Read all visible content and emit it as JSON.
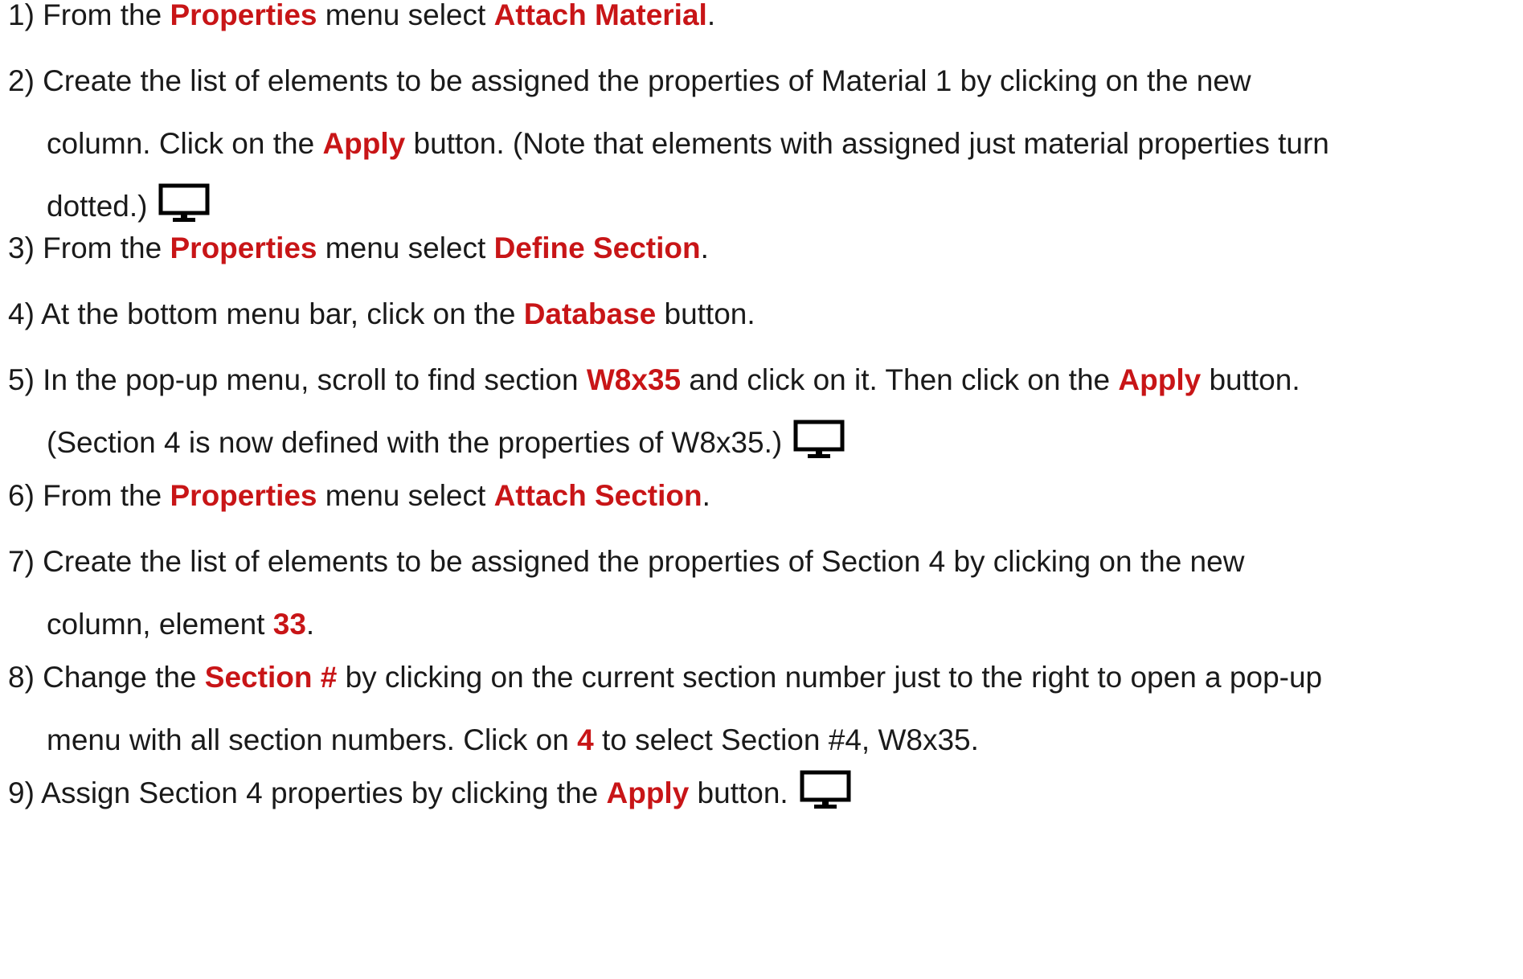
{
  "icon": "monitor-icon",
  "accent_color": "#c81517",
  "steps": [
    {
      "lines": [
        [
          {
            "t": "1) From the "
          },
          {
            "t": "Properties",
            "hl": true
          },
          {
            "t": " menu select "
          },
          {
            "t": "Attach Material",
            "hl": true
          },
          {
            "t": "."
          }
        ]
      ]
    },
    {
      "lines": [
        [
          {
            "t": "2) Create the list of elements to be assigned the properties of Material 1 by clicking on the new"
          }
        ],
        [
          {
            "t": "column. Click on the "
          },
          {
            "t": "Apply",
            "hl": true
          },
          {
            "t": " button. (Note that elements with assigned just material properties turn"
          }
        ],
        [
          {
            "t": "dotted.)"
          },
          {
            "icon": true
          }
        ]
      ]
    },
    {
      "lines": [
        [
          {
            "t": "3) From the "
          },
          {
            "t": "Properties",
            "hl": true
          },
          {
            "t": " menu select "
          },
          {
            "t": "Define Section",
            "hl": true
          },
          {
            "t": "."
          }
        ]
      ]
    },
    {
      "lines": [
        [
          {
            "t": "4) At the bottom menu bar, click on the "
          },
          {
            "t": "Database",
            "hl": true
          },
          {
            "t": " button."
          }
        ]
      ]
    },
    {
      "lines": [
        [
          {
            "t": "5) In the pop-up menu, scroll to find section "
          },
          {
            "t": "W8x35",
            "hl": true
          },
          {
            "t": " and click on it. Then click on the "
          },
          {
            "t": "Apply",
            "hl": true
          },
          {
            "t": " button."
          }
        ],
        [
          {
            "t": "(Section 4 is now defined with the properties of W8x35.)"
          },
          {
            "icon": true
          }
        ]
      ]
    },
    {
      "lines": [
        [
          {
            "t": "6) From the "
          },
          {
            "t": "Properties",
            "hl": true
          },
          {
            "t": " menu select "
          },
          {
            "t": "Attach Section",
            "hl": true
          },
          {
            "t": "."
          }
        ]
      ]
    },
    {
      "lines": [
        [
          {
            "t": "7) Create the list of elements to be assigned the properties of Section 4 by clicking on the new"
          }
        ],
        [
          {
            "t": "column, element "
          },
          {
            "t": "33",
            "hl": true
          },
          {
            "t": "."
          }
        ]
      ]
    },
    {
      "lines": [
        [
          {
            "t": "8) Change the "
          },
          {
            "t": "Section #",
            "hl": true
          },
          {
            "t": " by clicking on the current section number just to the right to open a pop-up"
          }
        ],
        [
          {
            "t": "menu with all section numbers. Click on "
          },
          {
            "t": "4",
            "hl": true
          },
          {
            "t": " to select Section #4, W8x35."
          }
        ]
      ]
    },
    {
      "lines": [
        [
          {
            "t": "9) Assign Section 4 properties by clicking the "
          },
          {
            "t": "Apply",
            "hl": true
          },
          {
            "t": " button."
          },
          {
            "icon": true
          }
        ]
      ]
    }
  ]
}
